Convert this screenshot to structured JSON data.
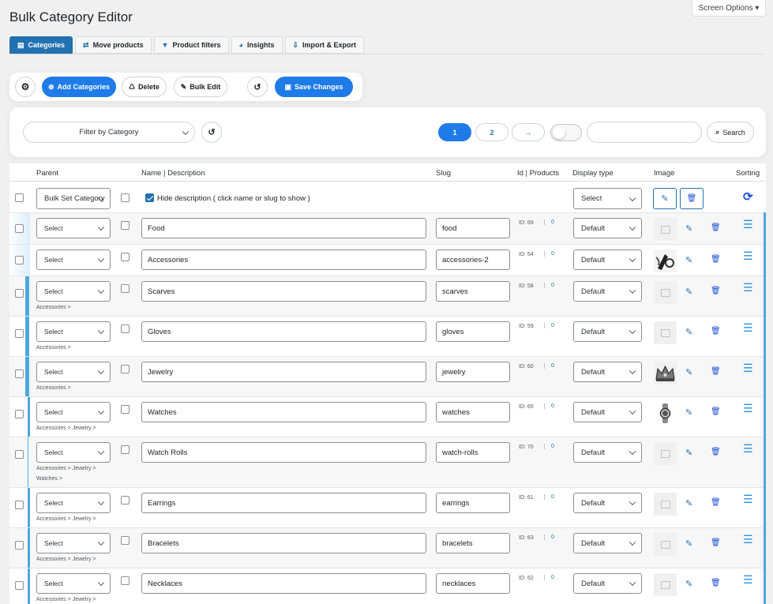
{
  "screen_options": "Screen Options ▾",
  "page_title": "Bulk Category Editor",
  "tabs": [
    {
      "label": "Categories",
      "icon": "list-icon"
    },
    {
      "label": "Move products",
      "icon": "swap-icon"
    },
    {
      "label": "Product filters",
      "icon": "funnel-icon"
    },
    {
      "label": "Insights",
      "icon": "pie-chart-icon"
    },
    {
      "label": "Import & Export",
      "icon": "import-icon"
    }
  ],
  "toolbar": {
    "add": "Add Categories",
    "delete": "Delete",
    "bulk_edit": "Bulk Edit",
    "save": "Save Changes"
  },
  "filter": {
    "category_placeholder": "Filter by Category",
    "pages": [
      "1",
      "2"
    ],
    "next": "→",
    "search_label": "Search",
    "search_value": ""
  },
  "table": {
    "headers": {
      "parent": "Parent",
      "name": "Name | Description",
      "slug": "Slug",
      "id": "Id | Products",
      "display": "Display type",
      "image": "Image",
      "sorting": "Sorting"
    },
    "bulk": {
      "parent": "Bulk Set Category",
      "hide_desc": "Hide description ( click name or slug to show )",
      "display": "Select"
    },
    "rows": [
      {
        "parent": "Select",
        "path1": "",
        "path2": "",
        "name": "Food",
        "slug": "food",
        "id": "ID: 69",
        "count": "0",
        "display": "Default",
        "image": "none"
      },
      {
        "parent": "Select",
        "path1": "",
        "path2": "",
        "name": "Accessories",
        "slug": "accessories-2",
        "id": "ID: 54",
        "count": "0",
        "display": "Default",
        "image": "accessories"
      },
      {
        "parent": "Select",
        "path1": "Accessories >",
        "path2": "",
        "name": "Scarves",
        "slug": "scarves",
        "id": "ID: 58",
        "count": "0",
        "display": "Default",
        "image": "none"
      },
      {
        "parent": "Select",
        "path1": "Accessories >",
        "path2": "",
        "name": "Gloves",
        "slug": "gloves",
        "id": "ID: 59",
        "count": "0",
        "display": "Default",
        "image": "none"
      },
      {
        "parent": "Select",
        "path1": "Accessories >",
        "path2": "",
        "name": "Jewelry",
        "slug": "jewelry",
        "id": "ID: 60",
        "count": "0",
        "display": "Default",
        "image": "crown"
      },
      {
        "parent": "Select",
        "path1": "Accessories > Jewelry >",
        "path2": "",
        "name": "Watches",
        "slug": "watches",
        "id": "ID: 65",
        "count": "0",
        "display": "Default",
        "image": "watch"
      },
      {
        "parent": "Select",
        "path1": "Accessories > Jewelry >",
        "path2": "Watches >",
        "name": "Watch Rolls",
        "slug": "watch-rolls",
        "id": "ID: 70",
        "count": "0",
        "display": "Default",
        "image": "none"
      },
      {
        "parent": "Select",
        "path1": "Accessories > Jewelry >",
        "path2": "",
        "name": "Earrings",
        "slug": "earrings",
        "id": "ID: 61",
        "count": "0",
        "display": "Default",
        "image": "none"
      },
      {
        "parent": "Select",
        "path1": "Accessories > Jewelry >",
        "path2": "",
        "name": "Bracelets",
        "slug": "bracelets",
        "id": "ID: 63",
        "count": "0",
        "display": "Default",
        "image": "none"
      },
      {
        "parent": "Select",
        "path1": "Accessories > Jewelry >",
        "path2": "",
        "name": "Necklaces",
        "slug": "necklaces",
        "id": "ID: 62",
        "count": "0",
        "display": "Default",
        "image": "none"
      }
    ]
  }
}
